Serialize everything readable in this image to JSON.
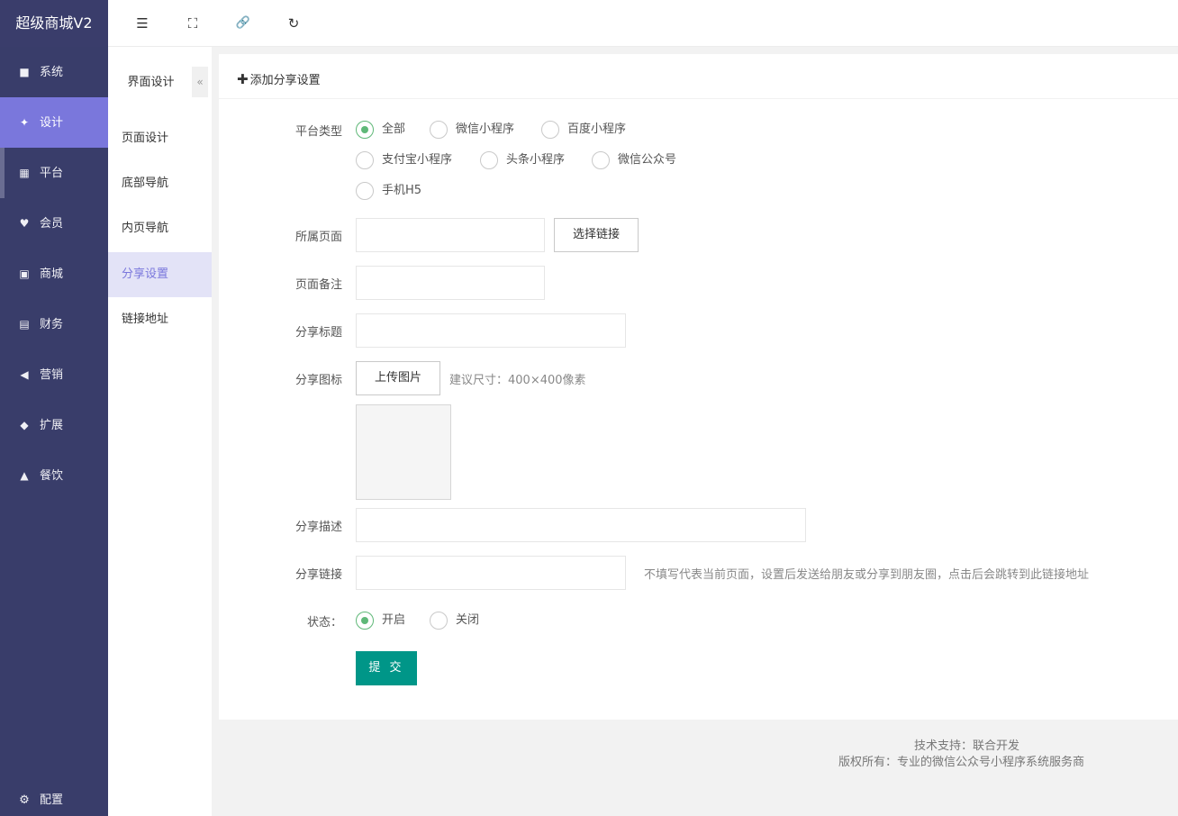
{
  "app": {
    "title": "超级商城V2"
  },
  "sidebar": {
    "items": [
      {
        "label": "系统",
        "icon": "monitor-icon",
        "glyph": "■"
      },
      {
        "label": "设计",
        "icon": "puzzle-icon",
        "glyph": "✦"
      },
      {
        "label": "平台",
        "icon": "grid-icon",
        "glyph": "▦"
      },
      {
        "label": "会员",
        "icon": "heart-icon",
        "glyph": "♥"
      },
      {
        "label": "商城",
        "icon": "bag-icon",
        "glyph": "▣"
      },
      {
        "label": "财务",
        "icon": "money-icon",
        "glyph": "▤"
      },
      {
        "label": "营销",
        "icon": "megaphone-icon",
        "glyph": "◀"
      },
      {
        "label": "扩展",
        "icon": "cube-icon",
        "glyph": "◆"
      },
      {
        "label": "餐饮",
        "icon": "cloche-icon",
        "glyph": "▲"
      }
    ],
    "active": "设计",
    "config": {
      "label": "配置",
      "icon": "gear-icon",
      "glyph": "⚙"
    }
  },
  "topbar": {
    "icons": [
      "menu-fold-icon",
      "fullscreen-icon",
      "link-icon",
      "refresh-icon"
    ],
    "glyphs": [
      "☰",
      "⛶",
      "🔗",
      "↻"
    ]
  },
  "subnav": {
    "title": "界面设计",
    "collapse_glyph": "«",
    "items": [
      "页面设计",
      "底部导航",
      "内页导航",
      "分享设置",
      "链接地址"
    ],
    "active": "分享设置"
  },
  "panel": {
    "header": {
      "plus": "✚",
      "label": "添加分享设置"
    },
    "form": {
      "platform": {
        "label": "平台类型",
        "options": [
          "全部",
          "微信小程序",
          "百度小程序",
          "支付宝小程序",
          "头条小程序",
          "微信公众号",
          "手机H5"
        ],
        "selected": "全部"
      },
      "page": {
        "label": "所属页面",
        "value": "",
        "select_button": "选择链接"
      },
      "remark": {
        "label": "页面备注",
        "value": ""
      },
      "title": {
        "label": "分享标题",
        "value": ""
      },
      "icon": {
        "label": "分享图标",
        "upload_button": "上传图片",
        "hint": "建议尺寸：400×400像素"
      },
      "description": {
        "label": "分享描述",
        "value": ""
      },
      "link": {
        "label": "分享链接",
        "value": "",
        "hint": "不填写代表当前页面，设置后发送给朋友或分享到朋友圈，点击后会跳转到此链接地址"
      },
      "status": {
        "label": "状态：",
        "options": [
          "开启",
          "关闭"
        ],
        "selected": "开启"
      },
      "submit": "提 交"
    }
  },
  "footer": {
    "support": "技术支持：联合开发",
    "copyright": "版权所有：专业的微信公众号小程序系统服务商"
  },
  "colors": {
    "sidebar": "#393d6a",
    "active": "#7a77dc",
    "submit": "#009688",
    "radio": "#5fb878"
  }
}
